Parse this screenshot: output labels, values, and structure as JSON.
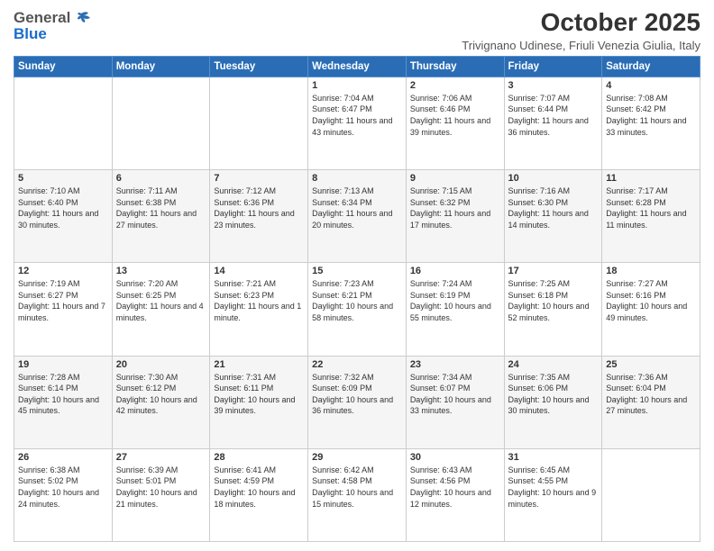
{
  "logo": {
    "general": "General",
    "blue": "Blue",
    "tagline": ""
  },
  "header": {
    "title": "October 2025",
    "subtitle": "Trivignano Udinese, Friuli Venezia Giulia, Italy"
  },
  "weekdays": [
    "Sunday",
    "Monday",
    "Tuesday",
    "Wednesday",
    "Thursday",
    "Friday",
    "Saturday"
  ],
  "weeks": [
    [
      {
        "day": "",
        "sunrise": "",
        "sunset": "",
        "daylight": ""
      },
      {
        "day": "",
        "sunrise": "",
        "sunset": "",
        "daylight": ""
      },
      {
        "day": "",
        "sunrise": "",
        "sunset": "",
        "daylight": ""
      },
      {
        "day": "1",
        "sunrise": "Sunrise: 7:04 AM",
        "sunset": "Sunset: 6:47 PM",
        "daylight": "Daylight: 11 hours and 43 minutes."
      },
      {
        "day": "2",
        "sunrise": "Sunrise: 7:06 AM",
        "sunset": "Sunset: 6:46 PM",
        "daylight": "Daylight: 11 hours and 39 minutes."
      },
      {
        "day": "3",
        "sunrise": "Sunrise: 7:07 AM",
        "sunset": "Sunset: 6:44 PM",
        "daylight": "Daylight: 11 hours and 36 minutes."
      },
      {
        "day": "4",
        "sunrise": "Sunrise: 7:08 AM",
        "sunset": "Sunset: 6:42 PM",
        "daylight": "Daylight: 11 hours and 33 minutes."
      }
    ],
    [
      {
        "day": "5",
        "sunrise": "Sunrise: 7:10 AM",
        "sunset": "Sunset: 6:40 PM",
        "daylight": "Daylight: 11 hours and 30 minutes."
      },
      {
        "day": "6",
        "sunrise": "Sunrise: 7:11 AM",
        "sunset": "Sunset: 6:38 PM",
        "daylight": "Daylight: 11 hours and 27 minutes."
      },
      {
        "day": "7",
        "sunrise": "Sunrise: 7:12 AM",
        "sunset": "Sunset: 6:36 PM",
        "daylight": "Daylight: 11 hours and 23 minutes."
      },
      {
        "day": "8",
        "sunrise": "Sunrise: 7:13 AM",
        "sunset": "Sunset: 6:34 PM",
        "daylight": "Daylight: 11 hours and 20 minutes."
      },
      {
        "day": "9",
        "sunrise": "Sunrise: 7:15 AM",
        "sunset": "Sunset: 6:32 PM",
        "daylight": "Daylight: 11 hours and 17 minutes."
      },
      {
        "day": "10",
        "sunrise": "Sunrise: 7:16 AM",
        "sunset": "Sunset: 6:30 PM",
        "daylight": "Daylight: 11 hours and 14 minutes."
      },
      {
        "day": "11",
        "sunrise": "Sunrise: 7:17 AM",
        "sunset": "Sunset: 6:28 PM",
        "daylight": "Daylight: 11 hours and 11 minutes."
      }
    ],
    [
      {
        "day": "12",
        "sunrise": "Sunrise: 7:19 AM",
        "sunset": "Sunset: 6:27 PM",
        "daylight": "Daylight: 11 hours and 7 minutes."
      },
      {
        "day": "13",
        "sunrise": "Sunrise: 7:20 AM",
        "sunset": "Sunset: 6:25 PM",
        "daylight": "Daylight: 11 hours and 4 minutes."
      },
      {
        "day": "14",
        "sunrise": "Sunrise: 7:21 AM",
        "sunset": "Sunset: 6:23 PM",
        "daylight": "Daylight: 11 hours and 1 minute."
      },
      {
        "day": "15",
        "sunrise": "Sunrise: 7:23 AM",
        "sunset": "Sunset: 6:21 PM",
        "daylight": "Daylight: 10 hours and 58 minutes."
      },
      {
        "day": "16",
        "sunrise": "Sunrise: 7:24 AM",
        "sunset": "Sunset: 6:19 PM",
        "daylight": "Daylight: 10 hours and 55 minutes."
      },
      {
        "day": "17",
        "sunrise": "Sunrise: 7:25 AM",
        "sunset": "Sunset: 6:18 PM",
        "daylight": "Daylight: 10 hours and 52 minutes."
      },
      {
        "day": "18",
        "sunrise": "Sunrise: 7:27 AM",
        "sunset": "Sunset: 6:16 PM",
        "daylight": "Daylight: 10 hours and 49 minutes."
      }
    ],
    [
      {
        "day": "19",
        "sunrise": "Sunrise: 7:28 AM",
        "sunset": "Sunset: 6:14 PM",
        "daylight": "Daylight: 10 hours and 45 minutes."
      },
      {
        "day": "20",
        "sunrise": "Sunrise: 7:30 AM",
        "sunset": "Sunset: 6:12 PM",
        "daylight": "Daylight: 10 hours and 42 minutes."
      },
      {
        "day": "21",
        "sunrise": "Sunrise: 7:31 AM",
        "sunset": "Sunset: 6:11 PM",
        "daylight": "Daylight: 10 hours and 39 minutes."
      },
      {
        "day": "22",
        "sunrise": "Sunrise: 7:32 AM",
        "sunset": "Sunset: 6:09 PM",
        "daylight": "Daylight: 10 hours and 36 minutes."
      },
      {
        "day": "23",
        "sunrise": "Sunrise: 7:34 AM",
        "sunset": "Sunset: 6:07 PM",
        "daylight": "Daylight: 10 hours and 33 minutes."
      },
      {
        "day": "24",
        "sunrise": "Sunrise: 7:35 AM",
        "sunset": "Sunset: 6:06 PM",
        "daylight": "Daylight: 10 hours and 30 minutes."
      },
      {
        "day": "25",
        "sunrise": "Sunrise: 7:36 AM",
        "sunset": "Sunset: 6:04 PM",
        "daylight": "Daylight: 10 hours and 27 minutes."
      }
    ],
    [
      {
        "day": "26",
        "sunrise": "Sunrise: 6:38 AM",
        "sunset": "Sunset: 5:02 PM",
        "daylight": "Daylight: 10 hours and 24 minutes."
      },
      {
        "day": "27",
        "sunrise": "Sunrise: 6:39 AM",
        "sunset": "Sunset: 5:01 PM",
        "daylight": "Daylight: 10 hours and 21 minutes."
      },
      {
        "day": "28",
        "sunrise": "Sunrise: 6:41 AM",
        "sunset": "Sunset: 4:59 PM",
        "daylight": "Daylight: 10 hours and 18 minutes."
      },
      {
        "day": "29",
        "sunrise": "Sunrise: 6:42 AM",
        "sunset": "Sunset: 4:58 PM",
        "daylight": "Daylight: 10 hours and 15 minutes."
      },
      {
        "day": "30",
        "sunrise": "Sunrise: 6:43 AM",
        "sunset": "Sunset: 4:56 PM",
        "daylight": "Daylight: 10 hours and 12 minutes."
      },
      {
        "day": "31",
        "sunrise": "Sunrise: 6:45 AM",
        "sunset": "Sunset: 4:55 PM",
        "daylight": "Daylight: 10 hours and 9 minutes."
      },
      {
        "day": "",
        "sunrise": "",
        "sunset": "",
        "daylight": ""
      }
    ]
  ]
}
